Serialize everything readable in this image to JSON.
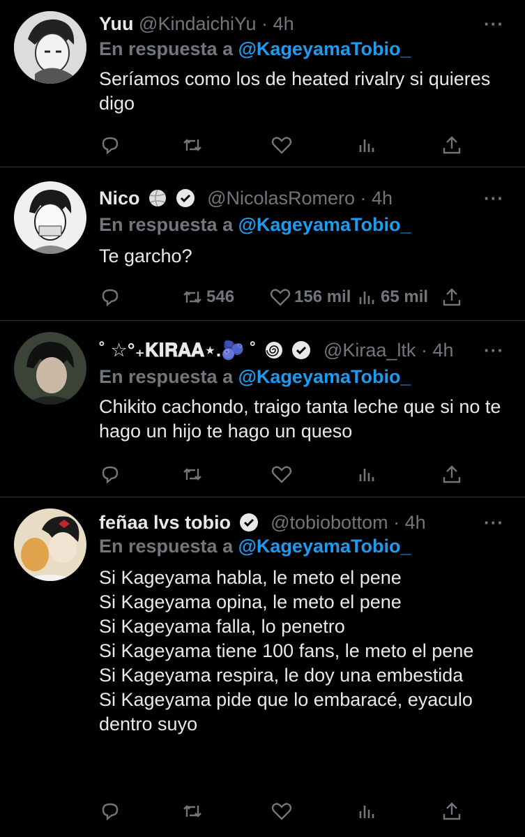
{
  "tweets": [
    {
      "name": "Yuu",
      "handle": "@KindaichiYu",
      "sep": " · ",
      "time": "4h",
      "reply_prefix": "En respuesta a ",
      "reply_to": "@KageyamaTobio_",
      "text": "Seríamos como los de heated rivalry si quieres digo",
      "more_icon": "more-icon"
    },
    {
      "name": "Nico",
      "handle": "@NicolasRomero",
      "sep": " · ",
      "time": "4h",
      "reply_prefix": "En respuesta a ",
      "reply_to": "@KageyamaTobio_",
      "text": "Te garcho?",
      "retweets": "546",
      "likes": "156 mil",
      "views": "65 mil"
    },
    {
      "name": "˚ ☆°₊𝐊𝐈𝐑𝐀𝐀⋆.🫐 ˚",
      "handle": "@Kiraa_ltk",
      "sep": " · ",
      "time": "4h",
      "reply_prefix": "En respuesta a ",
      "reply_to": "@KageyamaTobio_",
      "text": "Chikito cachondo, traigo tanta leche que si no te hago un hijo te hago un queso"
    },
    {
      "name": "feñaa lvs tobio",
      "handle": "@tobiobottom",
      "sep": " · ",
      "time": "4h",
      "reply_prefix": "En respuesta a ",
      "reply_to": "@KageyamaTobio_",
      "text": "Si Kageyama habla, le meto el pene\nSi Kageyama opina, le meto el pene\nSi Kageyama falla, lo penetro\nSi Kageyama tiene 100 fans, le meto el pene\nSi Kageyama respira, le doy una embestida\nSi Kageyama pide que lo embaracé, eyaculo dentro suyo"
    }
  ],
  "more_glyph": "···",
  "colors": {
    "background": "#000000",
    "text": "#e7e9ea",
    "muted": "#71767b",
    "link": "#1d9bf0",
    "divider": "#2f3336"
  }
}
